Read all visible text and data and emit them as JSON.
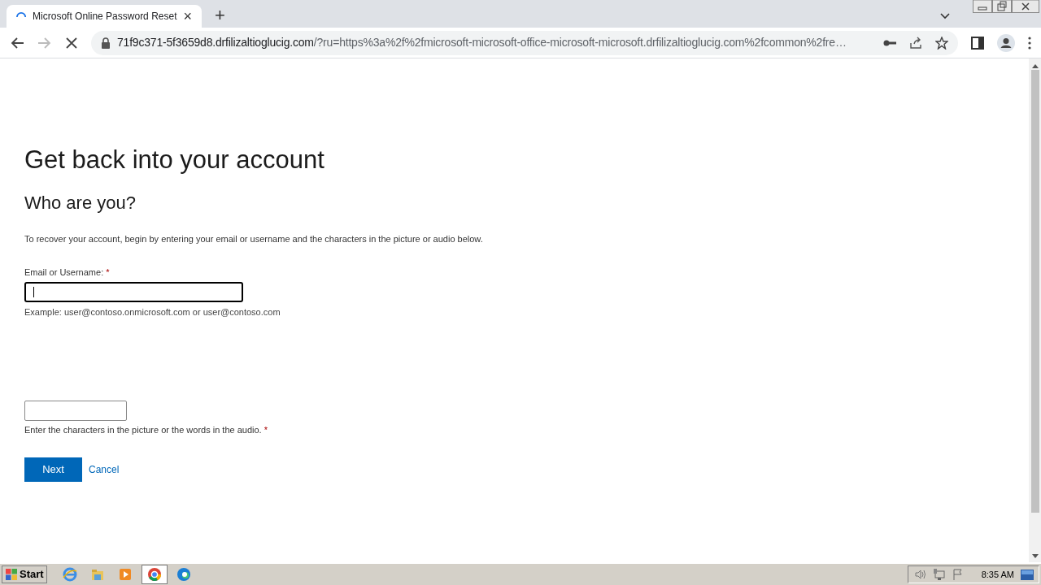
{
  "browser": {
    "tab": {
      "title": "Microsoft Online Password Reset",
      "loading": true,
      "close": "×"
    },
    "new_tab": "+",
    "address": {
      "host": "71f9c371-5f3659d8.drfilizaltioglucig.com",
      "rest": "/?ru=https%3a%2f%2fmicrosoft-microsoft-office-microsoft-microsoft.drfilizaltioglucig.com%2fcommon%2fre…"
    }
  },
  "page": {
    "title": "Get back into your account",
    "subtitle": "Who are you?",
    "intro": "To recover your account, begin by entering your email or username and the characters in the picture or audio below.",
    "email": {
      "label": "Email or Username:",
      "required_mark": "*",
      "focused": true,
      "hint": "Example: user@contoso.onmicrosoft.com or user@contoso.com"
    },
    "captcha": {
      "label": "Enter the characters in the picture or the words in the audio.",
      "required_mark": "*"
    },
    "buttons": {
      "next": "Next",
      "cancel": "Cancel"
    }
  },
  "taskbar": {
    "start": "Start",
    "apps": [
      {
        "kind": "ie",
        "selected": false
      },
      {
        "kind": "folder",
        "selected": false
      },
      {
        "kind": "media",
        "selected": false
      },
      {
        "kind": "chrome",
        "selected": true
      },
      {
        "kind": "edge",
        "selected": false
      }
    ],
    "clock": "8:35 AM"
  }
}
